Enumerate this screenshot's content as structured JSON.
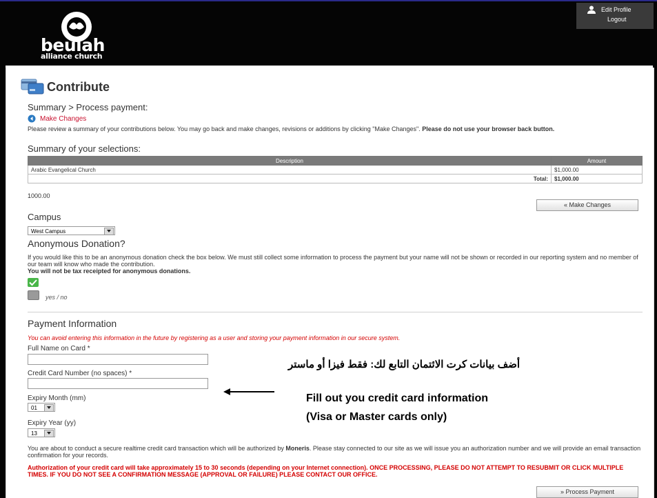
{
  "header": {
    "logo_text": "beulah",
    "logo_subtext": "alliance church",
    "edit_profile": "Edit Profile",
    "logout": "Logout"
  },
  "page": {
    "title": "Contribute",
    "breadcrumb": "Summary > Process payment:",
    "make_changes_link": "Make Changes",
    "review_text_1": "Please review a summary of your contributions below. You may go back and make changes, revisions or additions by clicking \"Make Changes\".",
    "review_text_bold": "Please do not use your browser back button.",
    "summary_heading": "Summary of your selections:"
  },
  "summary_table": {
    "headers": [
      "Description",
      "Amount"
    ],
    "rows": [
      {
        "description": "Arabic Evangelical Church",
        "amount": "$1,000.00"
      }
    ],
    "total_label": "Total:",
    "total_value": "$1,000.00"
  },
  "total_plain": "1000.00",
  "make_changes_button": "« Make Changes",
  "campus": {
    "heading": "Campus",
    "selected": "West Campus"
  },
  "anonymous": {
    "heading": "Anonymous Donation?",
    "text": "If you would like this to be an anonymous donation check the box below. We must still collect some information to process the payment but your name will not be shown or recorded in our reporting system and no member of our team will know who made the contribution.",
    "bold_text": "You will not be tax receipted for anonymous donations.",
    "checkbox_label": "yes / no"
  },
  "payment": {
    "heading": "Payment Information",
    "note": "You can avoid entering this information in the future by registering as a user and storing your payment information in our secure system.",
    "full_name_label": "Full Name on Card *",
    "card_number_label": "Credit Card Number (no spaces) *",
    "expiry_month_label": "Expiry Month (mm)",
    "expiry_month_value": "01",
    "expiry_year_label": "Expiry Year (yy)",
    "expiry_year_value": "13",
    "secure_text_1": "You are about to conduct a secure realtime credit card transaction which will be authorized by",
    "secure_text_bold": "Moneris",
    "secure_text_2": ". Please stay connected to our site as we will issue you an authorization number and we will provide an email transaction confirmation for your records.",
    "warning": "Authorization of your credit card will take approximately 15 to 30 seconds (depending on your Internet connection). ONCE PROCESSING, PLEASE DO NOT ATTEMPT TO RESUBMIT OR CLICK MULTIPLE TIMES. IF YOU DO NOT SEE A CONFIRMATION MESSAGE (APPROVAL OR FAILURE) PLEASE CONTACT OUR OFFICE.",
    "process_button": "» Process Payment"
  },
  "annotations": {
    "arabic": "أضف بيانات كرت الائتمان التابع لك: فقط فيزا أو ماستر",
    "english_line_1": "Fill out you credit card information",
    "english_line_2": "(Visa or Master cards only)"
  }
}
